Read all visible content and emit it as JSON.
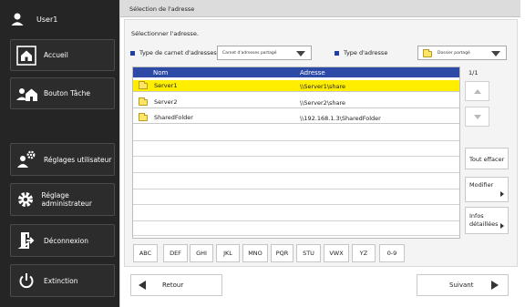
{
  "sidebar": {
    "user": "User1",
    "items": [
      {
        "label": "Accueil",
        "icon": "home-icon"
      },
      {
        "label": "Bouton Tâche",
        "icon": "task-button-icon"
      },
      {
        "label": "Réglages utilisateur",
        "icon": "user-settings-gear-icon"
      },
      {
        "label": "Réglage administrateur",
        "icon": "admin-gear-icon"
      },
      {
        "label": "Déconnexion",
        "icon": "logout-icon"
      },
      {
        "label": "Extinction",
        "icon": "power-icon"
      }
    ]
  },
  "header": {
    "title": "Sélection de l'adresse"
  },
  "main": {
    "instruction": "Sélectionner l'adresse.",
    "address_book_type": {
      "label": "Type de carnet d'adresses",
      "value": "Carnet d'adresses partagé"
    },
    "address_type": {
      "label": "Type d'adresse",
      "value": "Dossier partagé"
    },
    "table": {
      "columns": [
        "Nom",
        "Adresse"
      ],
      "rows": [
        {
          "name": "Server1",
          "address": "\\\\Server1\\share",
          "selected": true
        },
        {
          "name": "Server2",
          "address": "\\\\Server2\\share",
          "selected": false
        },
        {
          "name": "SharedFolder",
          "address": "\\\\192.168.1.3\\SharedFolder",
          "selected": false
        }
      ]
    },
    "page_indicator": "1/1",
    "buttons": {
      "clear_all": "Tout effacer",
      "modify": "Modifier",
      "details_line1": "Infos",
      "details_line2": "détaillées"
    },
    "index_keys": [
      "ABC",
      "DEF",
      "GHI",
      "JKL",
      "MNO",
      "PQR",
      "STU",
      "VWX",
      "YZ",
      "0-9"
    ]
  },
  "footer": {
    "back": "Retour",
    "next": "Suivant"
  },
  "colors": {
    "sidebar_bg": "#252525",
    "header_blue": "#2d4aa7",
    "selected_row": "#ffee00",
    "accent_square": "#1d3fa6"
  }
}
